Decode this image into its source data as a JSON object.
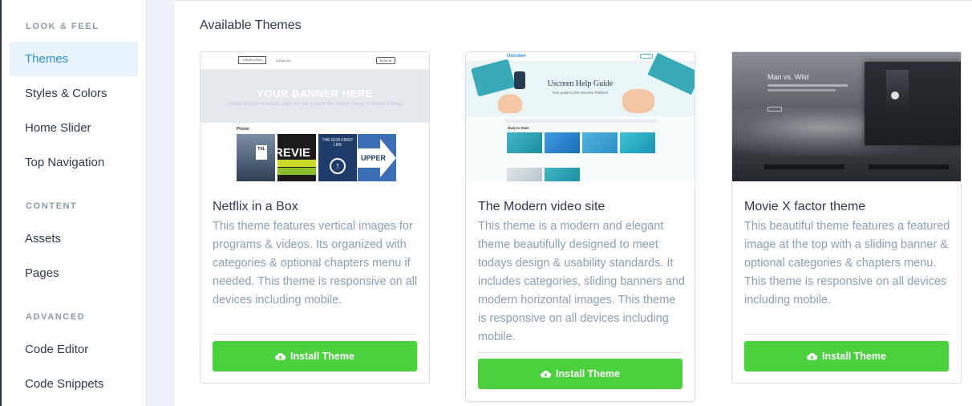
{
  "sidebar": {
    "sections": [
      {
        "label": "LOOK & FEEL",
        "items": [
          "Themes",
          "Styles & Colors",
          "Home Slider",
          "Top Navigation"
        ]
      },
      {
        "label": "CONTENT",
        "items": [
          "Assets",
          "Pages"
        ]
      },
      {
        "label": "ADVANCED",
        "items": [
          "Code Editor",
          "Code Snippets"
        ]
      }
    ],
    "active_item": "Themes"
  },
  "main": {
    "heading": "Available Themes",
    "install_label": "Install Theme",
    "themes": [
      {
        "title": "Netflix in a Box",
        "description": "This theme features vertical images for programs & videos. Its organized with categories & optional chapters menu if needed. This theme is responsive on all devices including mobile."
      },
      {
        "title": "The Modern video site",
        "description": "This theme is a modern and elegant theme beautifully designed to meet todays design & usability standards. It includes categories, sliding banners and modern horizontal images. This theme is responsive on all devices including mobile."
      },
      {
        "title": "Movie X factor theme",
        "description": "This beautiful theme features a featured image at the top with a sliding banner & optional categories & chapters menu. This theme is responsive on all devices including mobile."
      }
    ],
    "previews": {
      "netflix": {
        "logo": "YOUR LOGO",
        "nav": "CATALOG",
        "signin": "SIGN IN",
        "banner_title": "YOUR BANNER HERE",
        "banner_sub": "Upload images in assets, grab the link & paste the banner image in theme settings",
        "row_label": "Promo",
        "tiles": [
          "TXL",
          "REVIE",
          "THE GOD-FIRST LIFE",
          "UPPER"
        ]
      },
      "modern": {
        "brand": "Uscreen",
        "headline": "Uscreen Help Guide",
        "subline": "Your guide to the Uscreen Platform",
        "row_label": "How to Start"
      },
      "movie": {
        "headline": "Man vs. Wild"
      }
    }
  },
  "colors": {
    "accent": "#2e8fdc",
    "install": "#4cd13e",
    "muted": "#8aa0b6"
  }
}
